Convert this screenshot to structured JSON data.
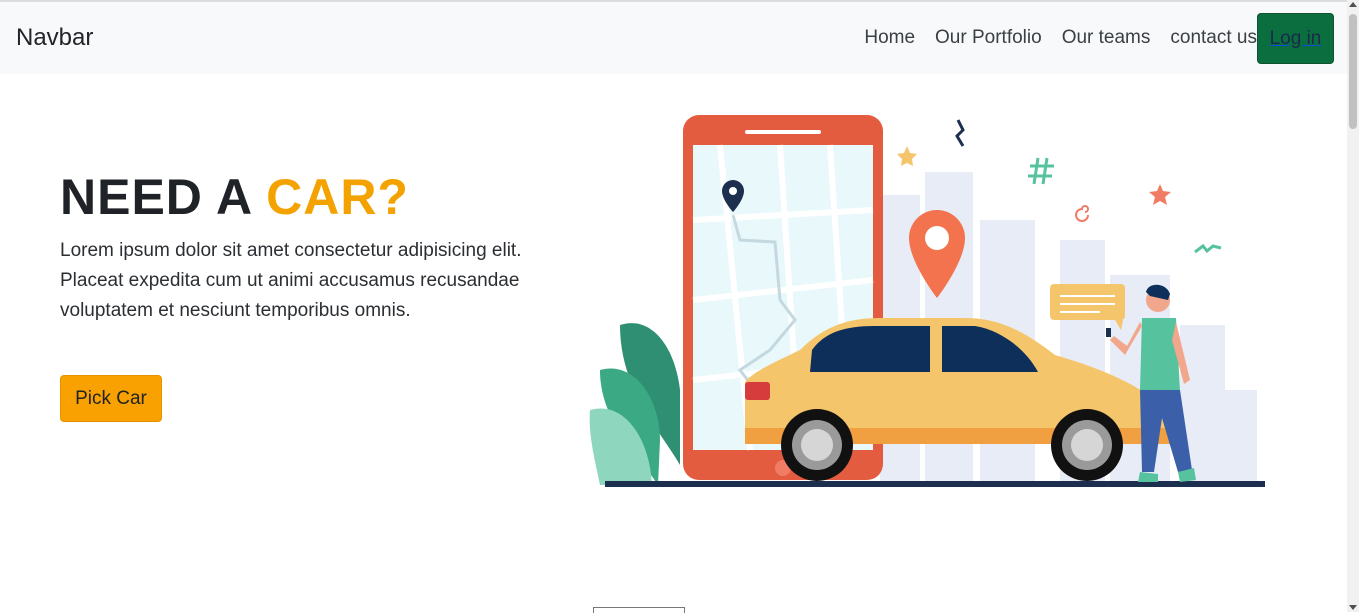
{
  "navbar": {
    "brand": "Navbar",
    "links": [
      "Home",
      "Our Portfolio",
      "Our teams",
      "contact us"
    ],
    "login": "Log in"
  },
  "hero": {
    "title_part1": "NEED A ",
    "title_accent": "CAR?",
    "text": "Lorem ipsum dolor sit amet consectetur adipisicing elit. Placeat expedita cum ut animi accusamus recusandae voluptatem et nesciunt temporibus omnis.",
    "button": "Pick Car"
  },
  "colors": {
    "accent": "#f4a200",
    "login_bg": "#0a6e3f",
    "phone": "#e45c40",
    "car": "#f5c56b",
    "navbar_bg": "#f8f9fa"
  },
  "icons": [
    "map-pin-icon",
    "location-pin-icon",
    "star-icon",
    "hashtag-icon",
    "chat-bubble-icon"
  ]
}
